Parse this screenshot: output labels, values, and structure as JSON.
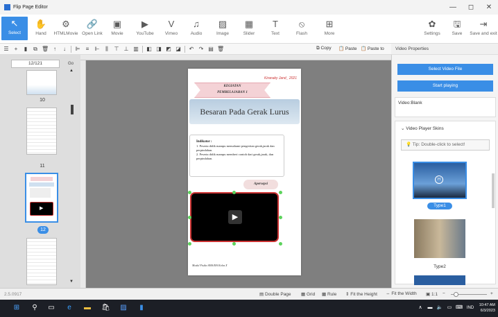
{
  "window": {
    "title": "Flip Page Editor",
    "buttons": [
      "—",
      "◻",
      "✕"
    ]
  },
  "toolbar": [
    {
      "label": "Select",
      "icon": "cursor-icon",
      "glyph": "↖"
    },
    {
      "label": "Hand",
      "icon": "hand-icon",
      "glyph": "✋"
    },
    {
      "label": "HTMLMovie",
      "icon": "html-movie-icon",
      "glyph": "⚙"
    },
    {
      "label": "Open Link",
      "icon": "link-icon",
      "glyph": "🔗"
    },
    {
      "label": "Movie",
      "icon": "movie-icon",
      "glyph": "▣"
    },
    {
      "label": "YouTube",
      "icon": "youtube-icon",
      "glyph": "▶"
    },
    {
      "label": "Vimeo",
      "icon": "vimeo-icon",
      "glyph": "V"
    },
    {
      "label": "Audio",
      "icon": "audio-icon",
      "glyph": "♫"
    },
    {
      "label": "Image",
      "icon": "image-icon",
      "glyph": "▨"
    },
    {
      "label": "Slider",
      "icon": "slider-icon",
      "glyph": "▦"
    },
    {
      "label": "Text",
      "icon": "text-icon",
      "glyph": "T"
    },
    {
      "label": "Flash",
      "icon": "flash-icon",
      "glyph": "⦸"
    },
    {
      "label": "More",
      "icon": "more-icon",
      "glyph": "⊞"
    },
    {
      "label": "Settings",
      "icon": "gear-icon",
      "glyph": "✿"
    },
    {
      "label": "Save",
      "icon": "save-icon",
      "glyph": "🖫"
    },
    {
      "label": "Save and exit",
      "icon": "save-exit-icon",
      "glyph": "⇥"
    }
  ],
  "subbar": {
    "copy": "Copy",
    "paste": "Paste",
    "paste_to": "Paste to"
  },
  "left": {
    "page_box": "12/121",
    "go": "Go",
    "thumbs": [
      {
        "num": "10"
      },
      {
        "num": "11"
      },
      {
        "num": "12"
      }
    ]
  },
  "page": {
    "author": "Kiranaky Jand_ 2021",
    "ribbon_line1": "KEGIATAN",
    "ribbon_line2": "PEMBELAJARAN 1",
    "title": "Besaran Pada Gerak Lurus",
    "indikator_head": "Indikator :",
    "item1": "1.  Peserta didik mampu memahami pengertian gerak,jarak dan perpindahan.",
    "item2": "2.  Peserta didik mampu memberi contoh dari gerak,jarak, dan perpindahan.",
    "apersepsi": "Apersepsi",
    "footer": "Modul Fisika SMA/MA Kelas X"
  },
  "right": {
    "header": "Video Properties",
    "select_btn": "Select Video File",
    "start_btn": "Start playing",
    "video_label": "Video:Blank",
    "skins_header": "Video Player Skins",
    "tip": "Tip: Double-click to select!",
    "skins": [
      {
        "label": "Type1"
      },
      {
        "label": "Type2"
      }
    ]
  },
  "status": {
    "version": "2.5.0917",
    "double_page": "Double Page",
    "grid": "Grid",
    "rule": "Rule",
    "fit_height": "Fit the Height",
    "fit_width": "Fit the Width",
    "zoom": "1:1"
  },
  "taskbar": {
    "lang": "IND",
    "time": "10:47 AM",
    "date": "6/3/2023"
  }
}
